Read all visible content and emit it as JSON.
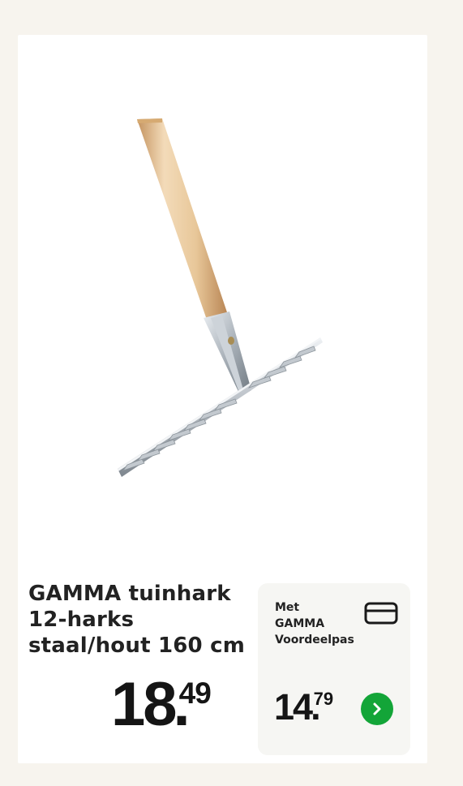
{
  "product": {
    "title": "GAMMA tuinhark\n12-harks\nstaal/hout 160 cm",
    "image_alt": "rake-image",
    "price": {
      "main": "18",
      "dot": ".",
      "cents": "49"
    }
  },
  "promo": {
    "label": "Met\nGAMMA\nVoordeelpas",
    "price": {
      "main": "14",
      "dot": ".",
      "cents": "79"
    },
    "card_icon": "credit-card-icon",
    "button_icon": "chevron-right-icon"
  },
  "colors": {
    "background": "#f7f4ee",
    "card": "#ffffff",
    "promo_box": "#f6f6f3",
    "button_green": "#13a538",
    "text": "#222222"
  }
}
